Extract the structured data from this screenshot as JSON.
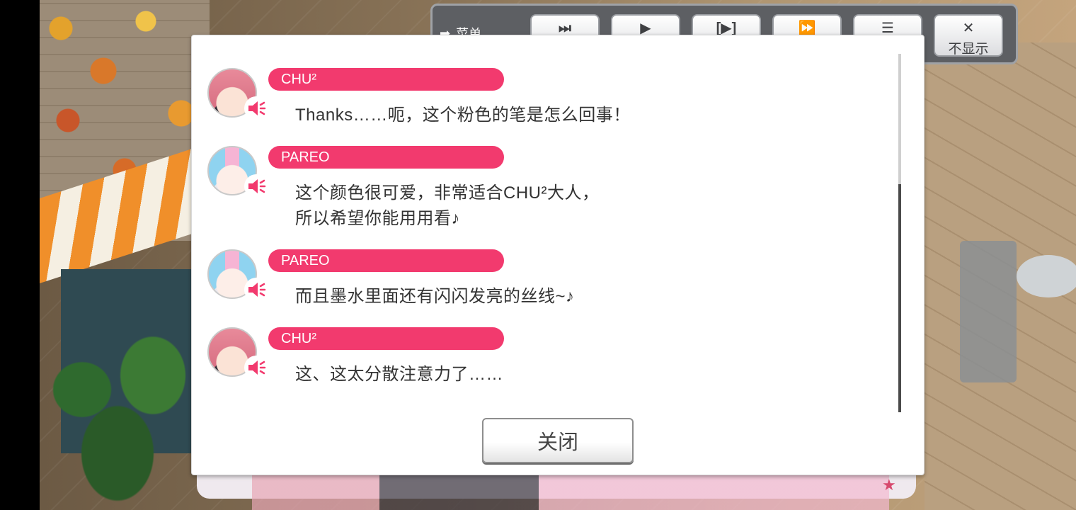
{
  "toolbar": {
    "menu_label": "菜单",
    "buttons": [
      {
        "icon": "skip-to-end-icon",
        "glyph": "⏭"
      },
      {
        "icon": "play-icon",
        "glyph": "▶"
      },
      {
        "icon": "auto-play-icon",
        "glyph": "[▶]"
      },
      {
        "icon": "fast-forward-icon",
        "glyph": "⏩"
      },
      {
        "icon": "log-icon",
        "glyph": "☰"
      }
    ],
    "hide_label": "不显示",
    "hide_glyph": "✕"
  },
  "dialog": {
    "entries": [
      {
        "speaker": "CHU²",
        "lines": [
          "Thanks……呃，这个粉色的笔是怎么回事！"
        ]
      },
      {
        "speaker": "PAREO",
        "lines": [
          "这个颜色很可爱，非常适合CHU²大人，",
          "所以希望你能用用看♪"
        ]
      },
      {
        "speaker": "PAREO",
        "lines": [
          "而且墨水里面还有闪闪发亮的丝线~♪"
        ]
      },
      {
        "speaker": "CHU²",
        "lines": [
          "这、这太分散注意力了……"
        ]
      }
    ],
    "close_label": "关闭"
  },
  "colors": {
    "name_bar": "#f23a6e",
    "speaker_icon": "#f23a6e"
  }
}
